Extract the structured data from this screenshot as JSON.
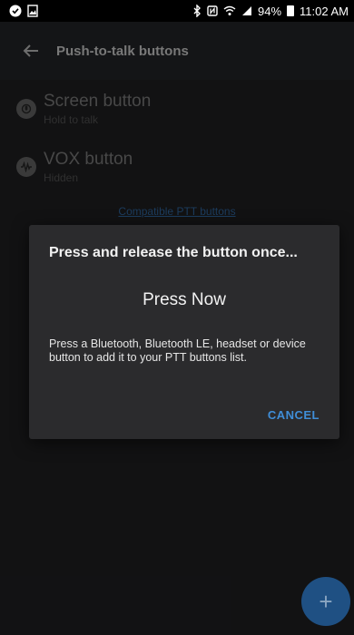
{
  "status_bar": {
    "battery": "94%",
    "time": "11:02 AM",
    "icons_left": [
      "check-circle-icon",
      "photo-icon"
    ],
    "icons_right": [
      "bluetooth-icon",
      "nfc-icon",
      "wifi-icon",
      "signal-icon"
    ]
  },
  "header": {
    "title": "Push-to-talk buttons"
  },
  "list": [
    {
      "title": "Screen button",
      "subtitle": "Hold to talk",
      "icon": "mic-icon"
    },
    {
      "title": "VOX button",
      "subtitle": "Hidden",
      "icon": "waveform-icon"
    }
  ],
  "link": {
    "label": "Compatible PTT buttons"
  },
  "dialog": {
    "title": "Press and release the button once...",
    "main_text": "Press Now",
    "description": "Press a Bluetooth, Bluetooth LE, headset or device button to add it to your PTT buttons list.",
    "cancel_label": "CANCEL"
  },
  "fab": {
    "label": "+"
  },
  "colors": {
    "accent": "#3f8ed8",
    "fab": "#1f5083",
    "dialog_bg": "#2b2b2d",
    "header_bg": "#202124"
  }
}
